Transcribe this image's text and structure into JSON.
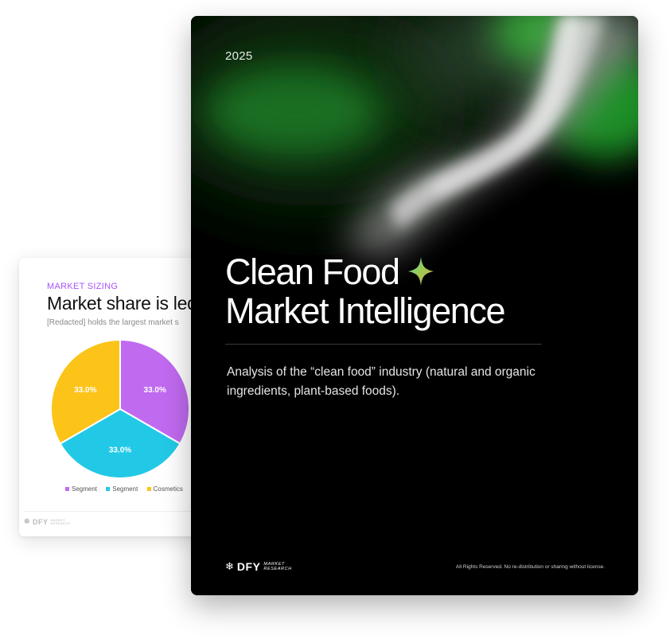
{
  "back_card": {
    "eyebrow": "MARKET SIZING",
    "title": "Market share is led",
    "subtitle": "[Redacted] holds the largest market s",
    "chart_data": {
      "type": "pie",
      "title": "",
      "slices": [
        {
          "label": "Segment",
          "value": 33.0,
          "display": "33.0%",
          "color": "#c06af0"
        },
        {
          "label": "Segment",
          "value": 33.0,
          "display": "33.0%",
          "color": "#22c9e6"
        },
        {
          "label": "Cosmetics",
          "value": 33.0,
          "display": "33.0%",
          "color": "#fcc419"
        }
      ],
      "legend_position": "bottom"
    },
    "legend": [
      {
        "label": "Segment",
        "color": "#c06af0"
      },
      {
        "label": "Segment",
        "color": "#22c9e6"
      },
      {
        "label": "Cosmetics",
        "color": "#fcc419"
      }
    ],
    "logo": {
      "word": "DFY",
      "line1": "MARKET",
      "line2": "RESEARCH"
    }
  },
  "cover": {
    "year": "2025",
    "title_line1": "Clean Food",
    "title_line2": "Market Intelligence",
    "description": "Analysis of the “clean food” industry (natural and organic ingredients, plant-based foods).",
    "logo": {
      "word": "DFY",
      "line1": "MARKET",
      "line2": "RESEARCH"
    },
    "rights": "All Rights Reserved. No re-distribution or sharing without license.",
    "accent_color": "#1fa82e"
  }
}
